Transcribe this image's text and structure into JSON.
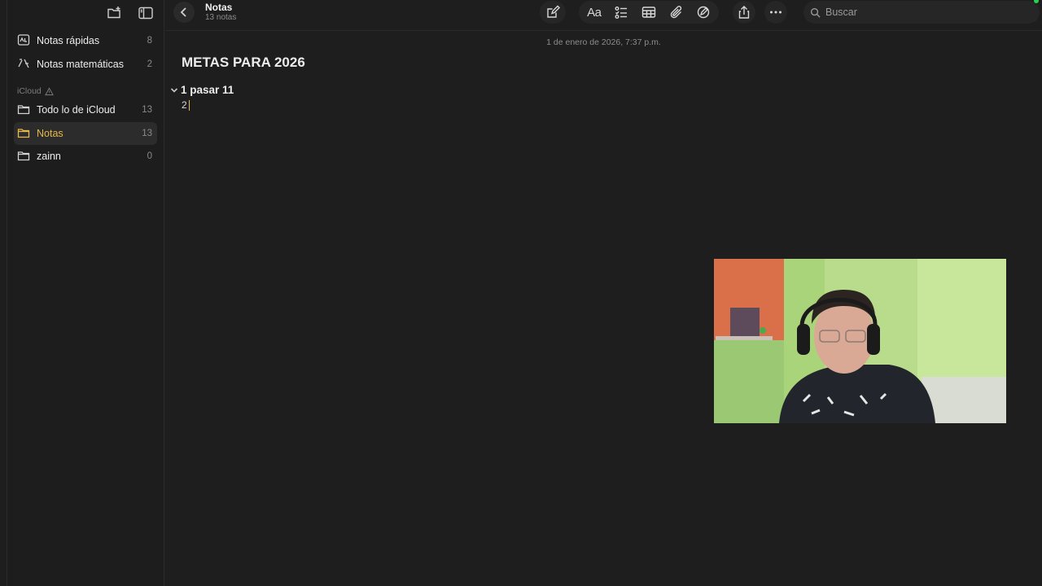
{
  "sidebar": {
    "items_top": [
      {
        "label": "Notas rápidas",
        "count": "8",
        "icon": "quick-note-icon"
      },
      {
        "label": "Notas matemáticas",
        "count": "2",
        "icon": "math-icon"
      }
    ],
    "section": {
      "label": "iCloud",
      "icon": "warning-icon"
    },
    "items_icloud": [
      {
        "label": "Todo lo de iCloud",
        "count": "13",
        "icon": "folder-icon"
      },
      {
        "label": "Notas",
        "count": "13",
        "icon": "folder-icon",
        "active": true
      },
      {
        "label": "zainn",
        "count": "0",
        "icon": "folder-icon"
      }
    ]
  },
  "header": {
    "title": "Notas",
    "subtitle": "13 notas",
    "format_label": "Aa"
  },
  "search": {
    "placeholder": "Buscar",
    "value": ""
  },
  "note": {
    "date": "1 de enero de 2026, 7:37 p.m.",
    "title": "METAS PARA 2026",
    "heading": "1 pasar 11",
    "line": "2"
  },
  "colors": {
    "accent": "#e8b84a",
    "background": "#1e1e1e",
    "status_dot": "#2bcf4f"
  }
}
